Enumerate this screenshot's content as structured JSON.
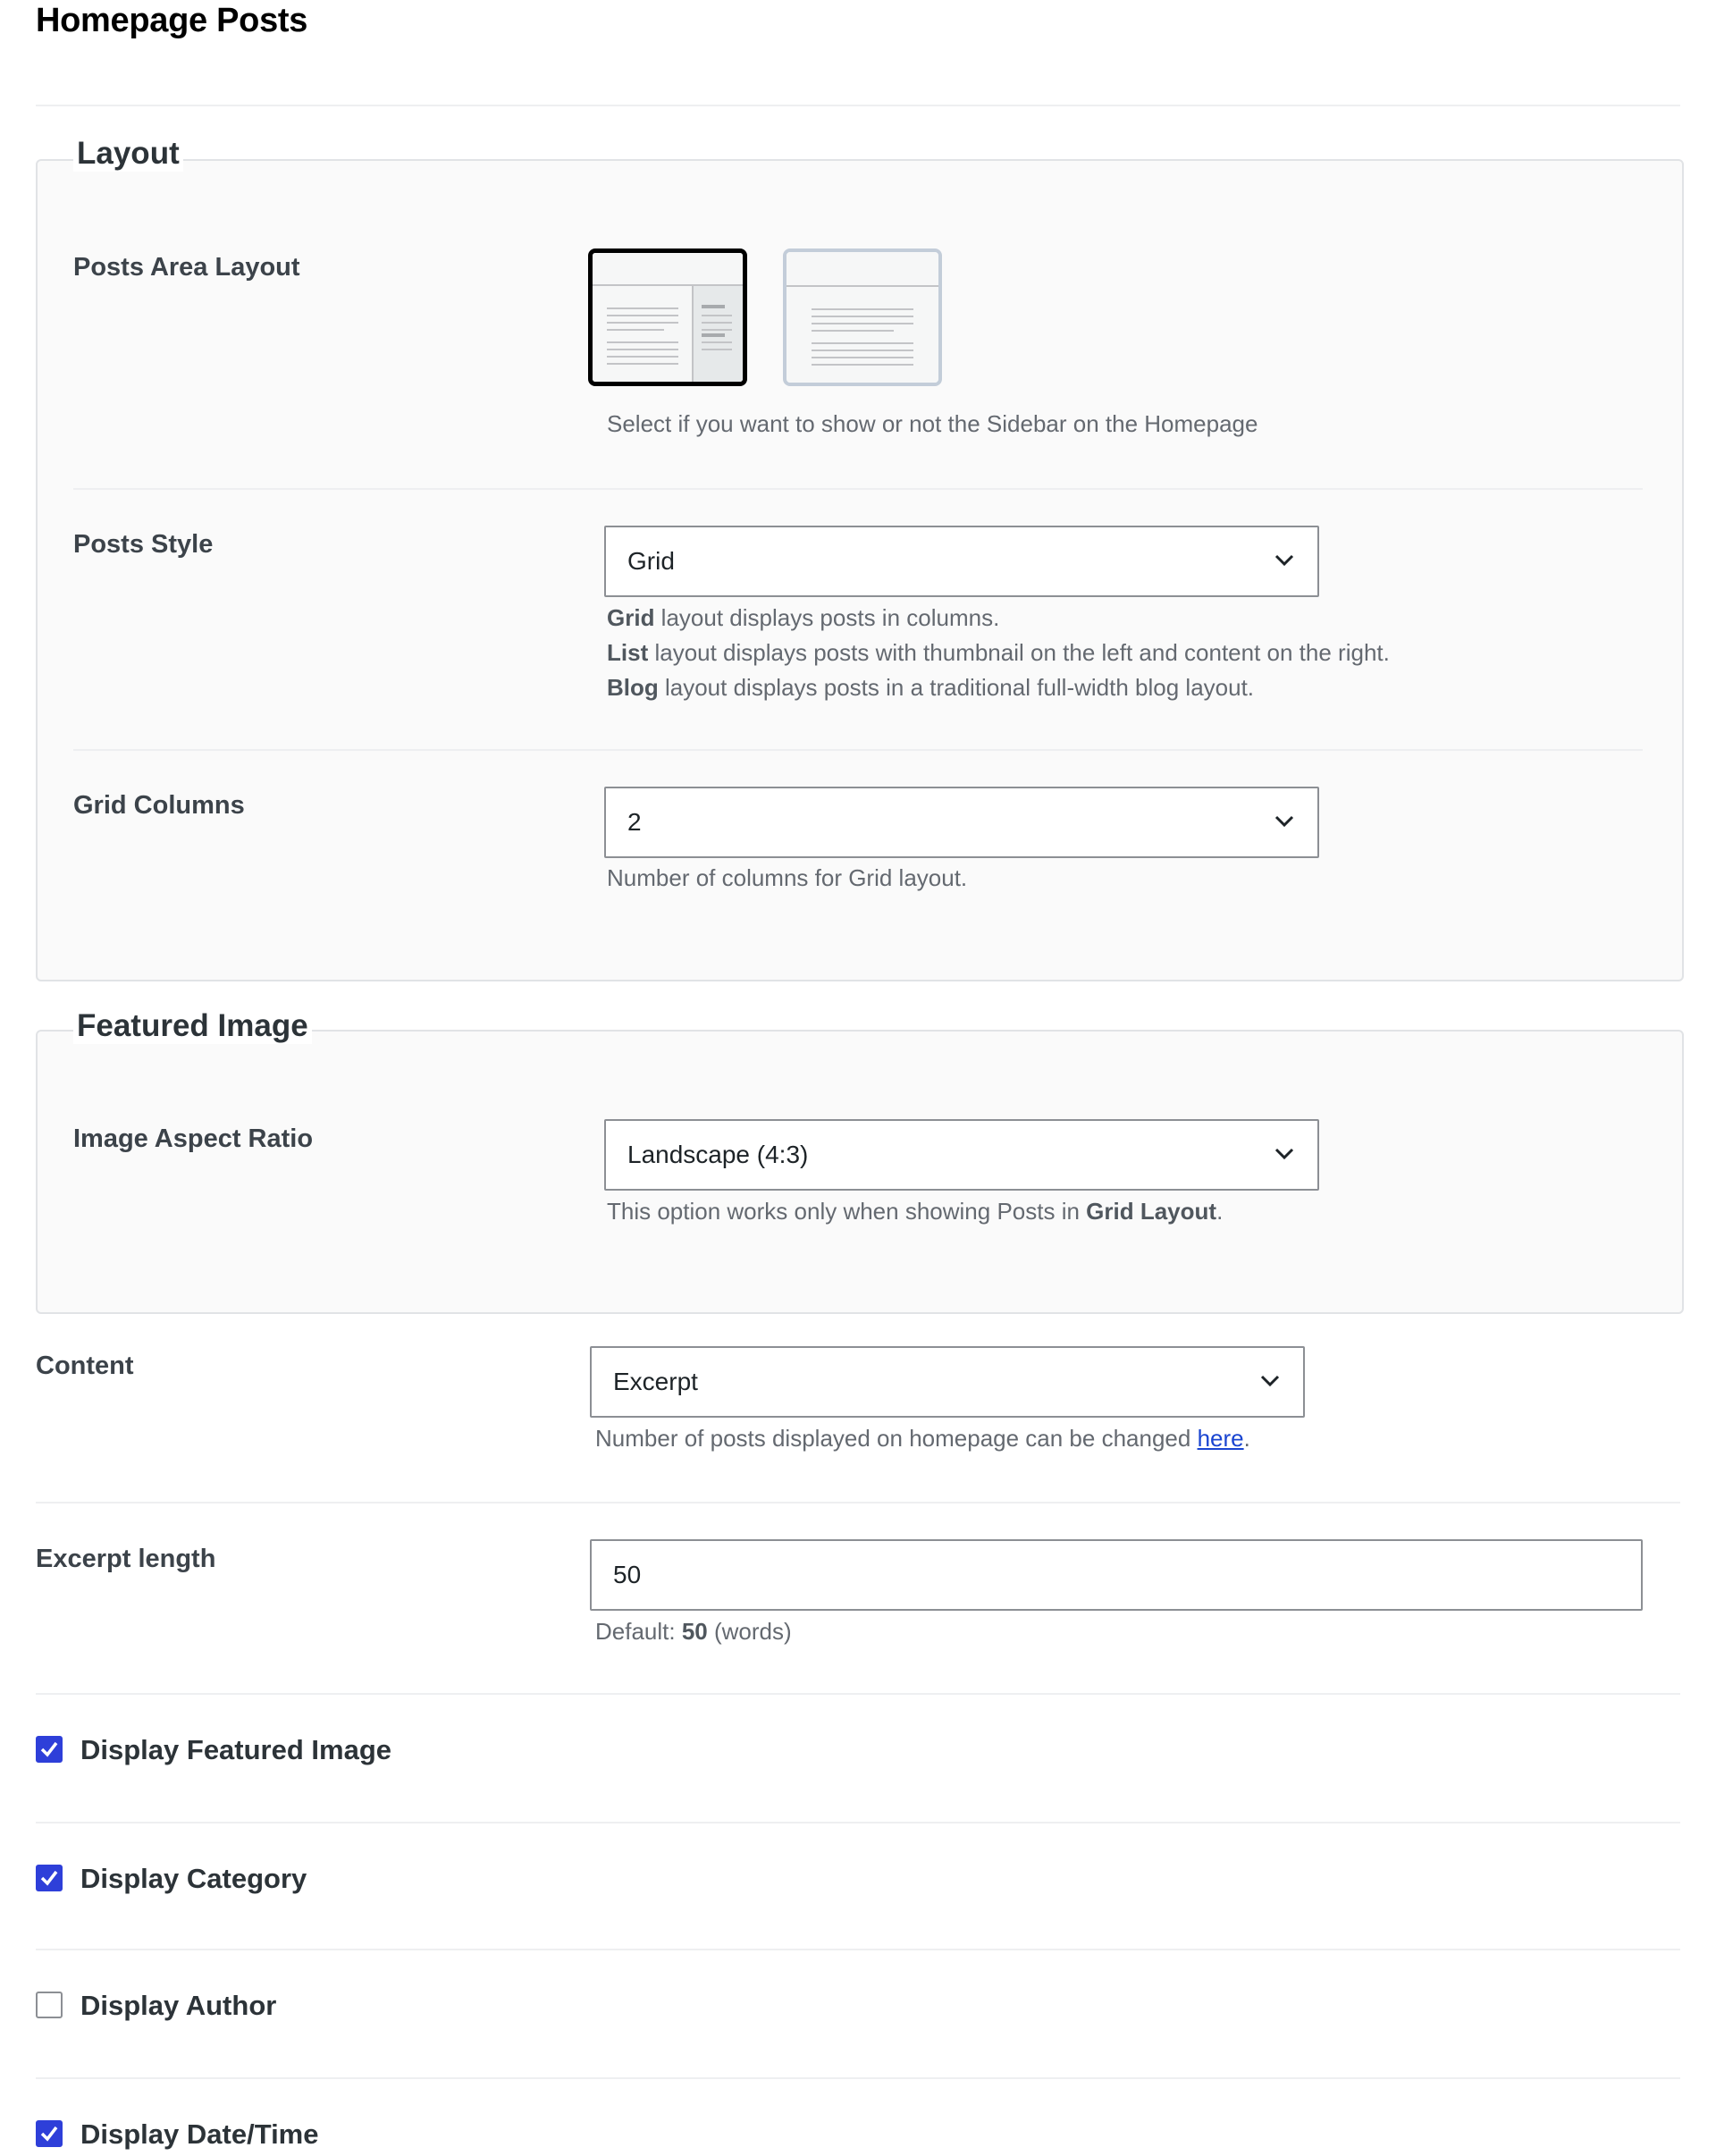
{
  "page": {
    "title": "Homepage Posts"
  },
  "layout_section": {
    "legend": "Layout",
    "posts_area_layout": {
      "label": "Posts Area Layout",
      "options": [
        "with-sidebar",
        "no-sidebar"
      ],
      "selected": "with-sidebar",
      "description": "Select if you want to show or not the Sidebar on the Homepage"
    },
    "posts_style": {
      "label": "Posts Style",
      "value": "Grid",
      "desc_lines": [
        {
          "strong": "Grid",
          "text": " layout displays posts in columns."
        },
        {
          "strong": "List",
          "text": " layout displays posts with thumbnail on the left and content on the right."
        },
        {
          "strong": "Blog",
          "text": " layout displays posts in a traditional full-width blog layout."
        }
      ]
    },
    "grid_columns": {
      "label": "Grid Columns",
      "value": "2",
      "description": "Number of columns for Grid layout."
    }
  },
  "featured_image_section": {
    "legend": "Featured Image",
    "aspect_ratio": {
      "label": "Image Aspect Ratio",
      "value": "Landscape (4:3)",
      "desc_prefix": "This option works only when showing Posts in ",
      "desc_strong": "Grid Layout",
      "desc_suffix": "."
    }
  },
  "content": {
    "label": "Content",
    "value": "Excerpt",
    "desc_prefix": "Number of posts displayed on homepage can be changed ",
    "desc_link": "here",
    "desc_suffix": "."
  },
  "excerpt_length": {
    "label": "Excerpt length",
    "value": "50",
    "default_prefix": "Default: ",
    "default_value": "50",
    "default_suffix": " (words)"
  },
  "checkboxes": [
    {
      "label": "Display Featured Image",
      "checked": true
    },
    {
      "label": "Display Category",
      "checked": true
    },
    {
      "label": "Display Author",
      "checked": false
    },
    {
      "label": "Display Date/Time",
      "checked": true
    }
  ],
  "colors": {
    "accent": "#2e3fd9",
    "selected_border": "#000000",
    "link": "#1a45d1"
  },
  "icons": {
    "select_arrow": "chevron-down-icon",
    "checkbox_checked": "checkmark-icon"
  }
}
